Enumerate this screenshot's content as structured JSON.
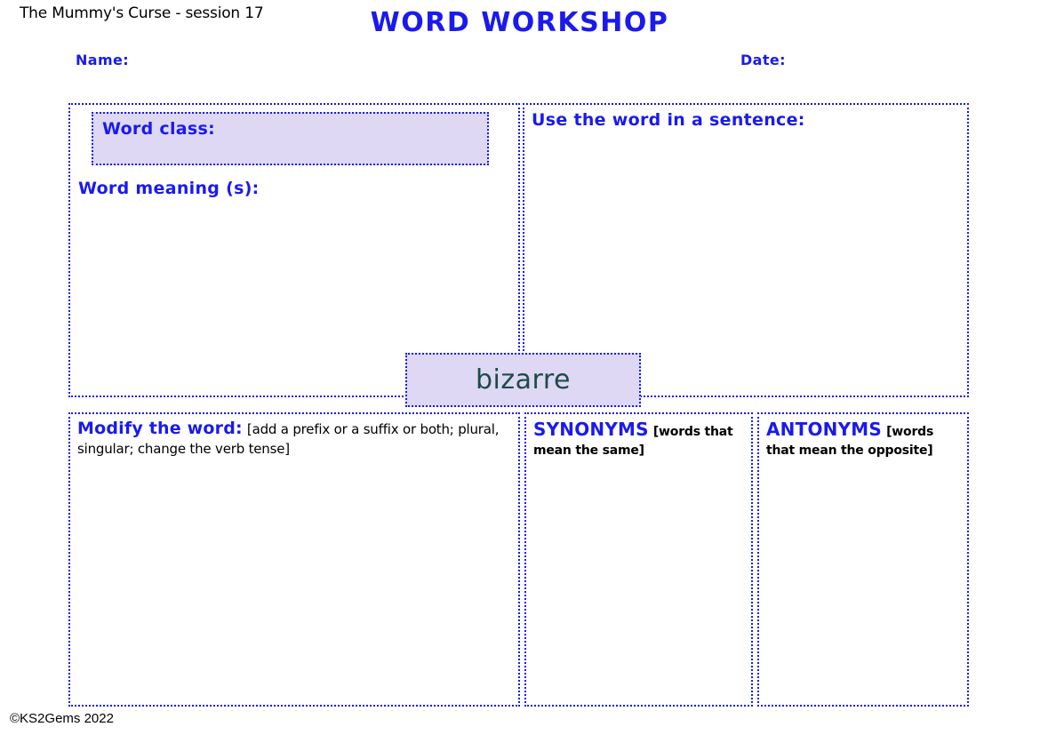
{
  "header": {
    "session_label": "The Mummy's Curse - session 17",
    "title": "WORD WORKSHOP",
    "name_label": "Name:",
    "date_label": "Date:"
  },
  "focus_word": {
    "word": "bizarre",
    "box_fill": "#ded8f5",
    "text_color": "#1d4b46"
  },
  "panels": {
    "word_meaning": {
      "word_class_label": "Word class:",
      "word_meaning_label": "Word meaning (s):"
    },
    "sentence": {
      "label": "Use the word in a sentence:"
    },
    "modify": {
      "label": "Modify the word:",
      "note": "[add a prefix or a suffix or both; plural, singular; change the verb tense]"
    },
    "synonyms": {
      "label": "SYNONYMS",
      "note": "[words that mean the same]"
    },
    "antonyms": {
      "label": "ANTONYMS",
      "note": "[words that mean the opposite]"
    }
  },
  "footer": {
    "copyright": "©KS2Gems 2022"
  },
  "theme": {
    "accent_blue": "#1a1aee",
    "panel_fill": "#ded8f5",
    "word_text": "#1d4b46",
    "border_style": "dotted"
  }
}
